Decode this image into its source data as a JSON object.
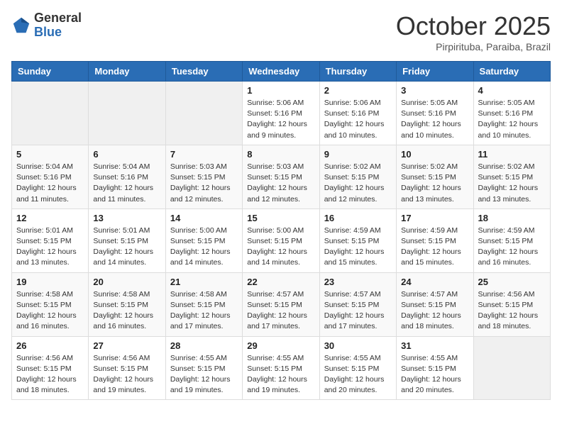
{
  "header": {
    "logo_general": "General",
    "logo_blue": "Blue",
    "month_title": "October 2025",
    "subtitle": "Pirpirituba, Paraiba, Brazil"
  },
  "weekdays": [
    "Sunday",
    "Monday",
    "Tuesday",
    "Wednesday",
    "Thursday",
    "Friday",
    "Saturday"
  ],
  "weeks": [
    [
      {
        "day": "",
        "info": ""
      },
      {
        "day": "",
        "info": ""
      },
      {
        "day": "",
        "info": ""
      },
      {
        "day": "1",
        "info": "Sunrise: 5:06 AM\nSunset: 5:16 PM\nDaylight: 12 hours\nand 9 minutes."
      },
      {
        "day": "2",
        "info": "Sunrise: 5:06 AM\nSunset: 5:16 PM\nDaylight: 12 hours\nand 10 minutes."
      },
      {
        "day": "3",
        "info": "Sunrise: 5:05 AM\nSunset: 5:16 PM\nDaylight: 12 hours\nand 10 minutes."
      },
      {
        "day": "4",
        "info": "Sunrise: 5:05 AM\nSunset: 5:16 PM\nDaylight: 12 hours\nand 10 minutes."
      }
    ],
    [
      {
        "day": "5",
        "info": "Sunrise: 5:04 AM\nSunset: 5:16 PM\nDaylight: 12 hours\nand 11 minutes."
      },
      {
        "day": "6",
        "info": "Sunrise: 5:04 AM\nSunset: 5:16 PM\nDaylight: 12 hours\nand 11 minutes."
      },
      {
        "day": "7",
        "info": "Sunrise: 5:03 AM\nSunset: 5:15 PM\nDaylight: 12 hours\nand 12 minutes."
      },
      {
        "day": "8",
        "info": "Sunrise: 5:03 AM\nSunset: 5:15 PM\nDaylight: 12 hours\nand 12 minutes."
      },
      {
        "day": "9",
        "info": "Sunrise: 5:02 AM\nSunset: 5:15 PM\nDaylight: 12 hours\nand 12 minutes."
      },
      {
        "day": "10",
        "info": "Sunrise: 5:02 AM\nSunset: 5:15 PM\nDaylight: 12 hours\nand 13 minutes."
      },
      {
        "day": "11",
        "info": "Sunrise: 5:02 AM\nSunset: 5:15 PM\nDaylight: 12 hours\nand 13 minutes."
      }
    ],
    [
      {
        "day": "12",
        "info": "Sunrise: 5:01 AM\nSunset: 5:15 PM\nDaylight: 12 hours\nand 13 minutes."
      },
      {
        "day": "13",
        "info": "Sunrise: 5:01 AM\nSunset: 5:15 PM\nDaylight: 12 hours\nand 14 minutes."
      },
      {
        "day": "14",
        "info": "Sunrise: 5:00 AM\nSunset: 5:15 PM\nDaylight: 12 hours\nand 14 minutes."
      },
      {
        "day": "15",
        "info": "Sunrise: 5:00 AM\nSunset: 5:15 PM\nDaylight: 12 hours\nand 14 minutes."
      },
      {
        "day": "16",
        "info": "Sunrise: 4:59 AM\nSunset: 5:15 PM\nDaylight: 12 hours\nand 15 minutes."
      },
      {
        "day": "17",
        "info": "Sunrise: 4:59 AM\nSunset: 5:15 PM\nDaylight: 12 hours\nand 15 minutes."
      },
      {
        "day": "18",
        "info": "Sunrise: 4:59 AM\nSunset: 5:15 PM\nDaylight: 12 hours\nand 16 minutes."
      }
    ],
    [
      {
        "day": "19",
        "info": "Sunrise: 4:58 AM\nSunset: 5:15 PM\nDaylight: 12 hours\nand 16 minutes."
      },
      {
        "day": "20",
        "info": "Sunrise: 4:58 AM\nSunset: 5:15 PM\nDaylight: 12 hours\nand 16 minutes."
      },
      {
        "day": "21",
        "info": "Sunrise: 4:58 AM\nSunset: 5:15 PM\nDaylight: 12 hours\nand 17 minutes."
      },
      {
        "day": "22",
        "info": "Sunrise: 4:57 AM\nSunset: 5:15 PM\nDaylight: 12 hours\nand 17 minutes."
      },
      {
        "day": "23",
        "info": "Sunrise: 4:57 AM\nSunset: 5:15 PM\nDaylight: 12 hours\nand 17 minutes."
      },
      {
        "day": "24",
        "info": "Sunrise: 4:57 AM\nSunset: 5:15 PM\nDaylight: 12 hours\nand 18 minutes."
      },
      {
        "day": "25",
        "info": "Sunrise: 4:56 AM\nSunset: 5:15 PM\nDaylight: 12 hours\nand 18 minutes."
      }
    ],
    [
      {
        "day": "26",
        "info": "Sunrise: 4:56 AM\nSunset: 5:15 PM\nDaylight: 12 hours\nand 18 minutes."
      },
      {
        "day": "27",
        "info": "Sunrise: 4:56 AM\nSunset: 5:15 PM\nDaylight: 12 hours\nand 19 minutes."
      },
      {
        "day": "28",
        "info": "Sunrise: 4:55 AM\nSunset: 5:15 PM\nDaylight: 12 hours\nand 19 minutes."
      },
      {
        "day": "29",
        "info": "Sunrise: 4:55 AM\nSunset: 5:15 PM\nDaylight: 12 hours\nand 19 minutes."
      },
      {
        "day": "30",
        "info": "Sunrise: 4:55 AM\nSunset: 5:15 PM\nDaylight: 12 hours\nand 20 minutes."
      },
      {
        "day": "31",
        "info": "Sunrise: 4:55 AM\nSunset: 5:15 PM\nDaylight: 12 hours\nand 20 minutes."
      },
      {
        "day": "",
        "info": ""
      }
    ]
  ]
}
